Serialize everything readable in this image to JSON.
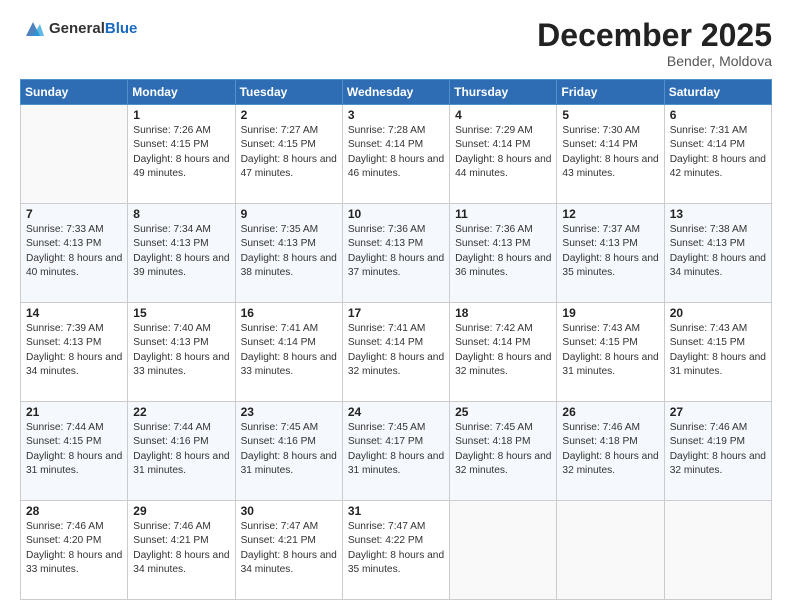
{
  "header": {
    "logo_general": "General",
    "logo_blue": "Blue",
    "month": "December 2025",
    "location": "Bender, Moldova"
  },
  "weekdays": [
    "Sunday",
    "Monday",
    "Tuesday",
    "Wednesday",
    "Thursday",
    "Friday",
    "Saturday"
  ],
  "weeks": [
    [
      {
        "day": "",
        "sunrise": "",
        "sunset": "",
        "daylight": ""
      },
      {
        "day": "1",
        "sunrise": "Sunrise: 7:26 AM",
        "sunset": "Sunset: 4:15 PM",
        "daylight": "Daylight: 8 hours and 49 minutes."
      },
      {
        "day": "2",
        "sunrise": "Sunrise: 7:27 AM",
        "sunset": "Sunset: 4:15 PM",
        "daylight": "Daylight: 8 hours and 47 minutes."
      },
      {
        "day": "3",
        "sunrise": "Sunrise: 7:28 AM",
        "sunset": "Sunset: 4:14 PM",
        "daylight": "Daylight: 8 hours and 46 minutes."
      },
      {
        "day": "4",
        "sunrise": "Sunrise: 7:29 AM",
        "sunset": "Sunset: 4:14 PM",
        "daylight": "Daylight: 8 hours and 44 minutes."
      },
      {
        "day": "5",
        "sunrise": "Sunrise: 7:30 AM",
        "sunset": "Sunset: 4:14 PM",
        "daylight": "Daylight: 8 hours and 43 minutes."
      },
      {
        "day": "6",
        "sunrise": "Sunrise: 7:31 AM",
        "sunset": "Sunset: 4:14 PM",
        "daylight": "Daylight: 8 hours and 42 minutes."
      }
    ],
    [
      {
        "day": "7",
        "sunrise": "Sunrise: 7:33 AM",
        "sunset": "Sunset: 4:13 PM",
        "daylight": "Daylight: 8 hours and 40 minutes."
      },
      {
        "day": "8",
        "sunrise": "Sunrise: 7:34 AM",
        "sunset": "Sunset: 4:13 PM",
        "daylight": "Daylight: 8 hours and 39 minutes."
      },
      {
        "day": "9",
        "sunrise": "Sunrise: 7:35 AM",
        "sunset": "Sunset: 4:13 PM",
        "daylight": "Daylight: 8 hours and 38 minutes."
      },
      {
        "day": "10",
        "sunrise": "Sunrise: 7:36 AM",
        "sunset": "Sunset: 4:13 PM",
        "daylight": "Daylight: 8 hours and 37 minutes."
      },
      {
        "day": "11",
        "sunrise": "Sunrise: 7:36 AM",
        "sunset": "Sunset: 4:13 PM",
        "daylight": "Daylight: 8 hours and 36 minutes."
      },
      {
        "day": "12",
        "sunrise": "Sunrise: 7:37 AM",
        "sunset": "Sunset: 4:13 PM",
        "daylight": "Daylight: 8 hours and 35 minutes."
      },
      {
        "day": "13",
        "sunrise": "Sunrise: 7:38 AM",
        "sunset": "Sunset: 4:13 PM",
        "daylight": "Daylight: 8 hours and 34 minutes."
      }
    ],
    [
      {
        "day": "14",
        "sunrise": "Sunrise: 7:39 AM",
        "sunset": "Sunset: 4:13 PM",
        "daylight": "Daylight: 8 hours and 34 minutes."
      },
      {
        "day": "15",
        "sunrise": "Sunrise: 7:40 AM",
        "sunset": "Sunset: 4:13 PM",
        "daylight": "Daylight: 8 hours and 33 minutes."
      },
      {
        "day": "16",
        "sunrise": "Sunrise: 7:41 AM",
        "sunset": "Sunset: 4:14 PM",
        "daylight": "Daylight: 8 hours and 33 minutes."
      },
      {
        "day": "17",
        "sunrise": "Sunrise: 7:41 AM",
        "sunset": "Sunset: 4:14 PM",
        "daylight": "Daylight: 8 hours and 32 minutes."
      },
      {
        "day": "18",
        "sunrise": "Sunrise: 7:42 AM",
        "sunset": "Sunset: 4:14 PM",
        "daylight": "Daylight: 8 hours and 32 minutes."
      },
      {
        "day": "19",
        "sunrise": "Sunrise: 7:43 AM",
        "sunset": "Sunset: 4:15 PM",
        "daylight": "Daylight: 8 hours and 31 minutes."
      },
      {
        "day": "20",
        "sunrise": "Sunrise: 7:43 AM",
        "sunset": "Sunset: 4:15 PM",
        "daylight": "Daylight: 8 hours and 31 minutes."
      }
    ],
    [
      {
        "day": "21",
        "sunrise": "Sunrise: 7:44 AM",
        "sunset": "Sunset: 4:15 PM",
        "daylight": "Daylight: 8 hours and 31 minutes."
      },
      {
        "day": "22",
        "sunrise": "Sunrise: 7:44 AM",
        "sunset": "Sunset: 4:16 PM",
        "daylight": "Daylight: 8 hours and 31 minutes."
      },
      {
        "day": "23",
        "sunrise": "Sunrise: 7:45 AM",
        "sunset": "Sunset: 4:16 PM",
        "daylight": "Daylight: 8 hours and 31 minutes."
      },
      {
        "day": "24",
        "sunrise": "Sunrise: 7:45 AM",
        "sunset": "Sunset: 4:17 PM",
        "daylight": "Daylight: 8 hours and 31 minutes."
      },
      {
        "day": "25",
        "sunrise": "Sunrise: 7:45 AM",
        "sunset": "Sunset: 4:18 PM",
        "daylight": "Daylight: 8 hours and 32 minutes."
      },
      {
        "day": "26",
        "sunrise": "Sunrise: 7:46 AM",
        "sunset": "Sunset: 4:18 PM",
        "daylight": "Daylight: 8 hours and 32 minutes."
      },
      {
        "day": "27",
        "sunrise": "Sunrise: 7:46 AM",
        "sunset": "Sunset: 4:19 PM",
        "daylight": "Daylight: 8 hours and 32 minutes."
      }
    ],
    [
      {
        "day": "28",
        "sunrise": "Sunrise: 7:46 AM",
        "sunset": "Sunset: 4:20 PM",
        "daylight": "Daylight: 8 hours and 33 minutes."
      },
      {
        "day": "29",
        "sunrise": "Sunrise: 7:46 AM",
        "sunset": "Sunset: 4:21 PM",
        "daylight": "Daylight: 8 hours and 34 minutes."
      },
      {
        "day": "30",
        "sunrise": "Sunrise: 7:47 AM",
        "sunset": "Sunset: 4:21 PM",
        "daylight": "Daylight: 8 hours and 34 minutes."
      },
      {
        "day": "31",
        "sunrise": "Sunrise: 7:47 AM",
        "sunset": "Sunset: 4:22 PM",
        "daylight": "Daylight: 8 hours and 35 minutes."
      },
      {
        "day": "",
        "sunrise": "",
        "sunset": "",
        "daylight": ""
      },
      {
        "day": "",
        "sunrise": "",
        "sunset": "",
        "daylight": ""
      },
      {
        "day": "",
        "sunrise": "",
        "sunset": "",
        "daylight": ""
      }
    ]
  ]
}
